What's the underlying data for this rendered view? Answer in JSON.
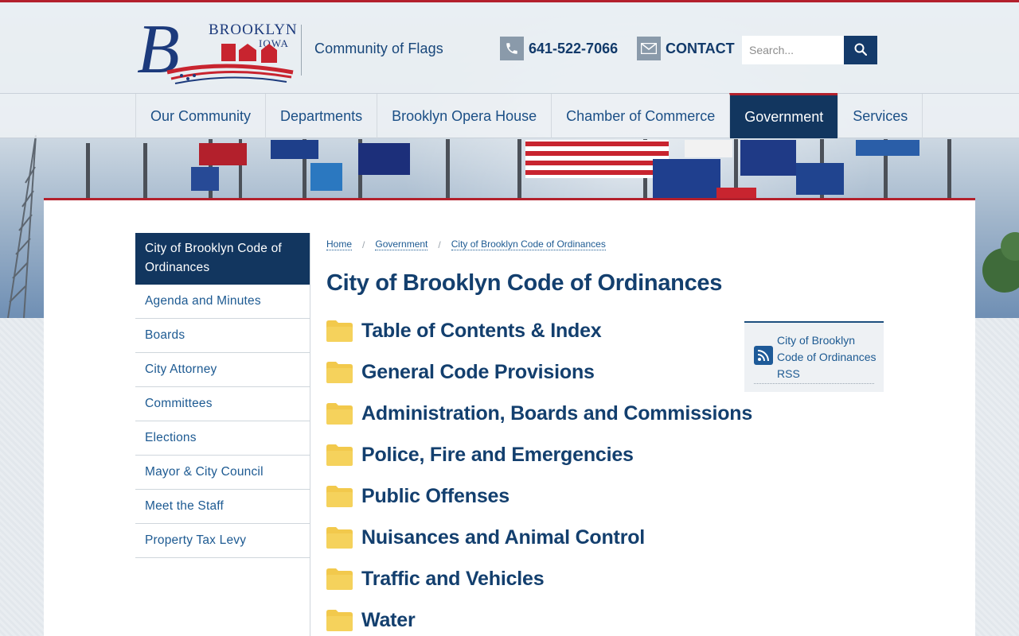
{
  "colors": {
    "accent_red": "#b3202c",
    "navy": "#12365f",
    "link_blue": "#1d5a92",
    "heading_blue": "#133f6e",
    "folder_yellow": "#f2c94c"
  },
  "header": {
    "logo": {
      "wordmark": "BROOKLYN",
      "state": "IOWA",
      "initial": "B"
    },
    "tagline": "Community of Flags",
    "phone": {
      "icon": "phone-icon",
      "number": "641-522-7066"
    },
    "contact": {
      "icon": "mail-icon",
      "label": "CONTACT"
    },
    "search": {
      "placeholder": "Search...",
      "value": "",
      "icon": "search-icon"
    }
  },
  "nav": {
    "items": [
      {
        "label": "Our Community",
        "active": false
      },
      {
        "label": "Departments",
        "active": false
      },
      {
        "label": "Brooklyn Opera House",
        "active": false
      },
      {
        "label": "Chamber of Commerce",
        "active": false
      },
      {
        "label": "Government",
        "active": true
      },
      {
        "label": "Services",
        "active": false
      }
    ]
  },
  "sidebar": {
    "items": [
      {
        "label": "City of Brooklyn Code of Ordinances",
        "active": true
      },
      {
        "label": "Agenda and Minutes",
        "active": false
      },
      {
        "label": "Boards",
        "active": false
      },
      {
        "label": "City Attorney",
        "active": false
      },
      {
        "label": "Committees",
        "active": false
      },
      {
        "label": "Elections",
        "active": false
      },
      {
        "label": "Mayor & City Council",
        "active": false
      },
      {
        "label": "Meet the Staff",
        "active": false
      },
      {
        "label": "Property Tax Levy",
        "active": false
      }
    ]
  },
  "breadcrumb": {
    "items": [
      "Home",
      "Government",
      "City of Brooklyn Code of Ordinances"
    ],
    "separator": "/"
  },
  "main": {
    "title": "City of Brooklyn Code of Ordinances",
    "folders": [
      {
        "label": "Table of Contents & Index",
        "icon": "folder-icon"
      },
      {
        "label": "General Code Provisions",
        "icon": "folder-icon"
      },
      {
        "label": "Administration, Boards and Commissions",
        "icon": "folder-icon"
      },
      {
        "label": "Police, Fire and Emergencies",
        "icon": "folder-icon"
      },
      {
        "label": "Public Offenses",
        "icon": "folder-icon"
      },
      {
        "label": "Nuisances and Animal Control",
        "icon": "folder-icon"
      },
      {
        "label": "Traffic and Vehicles",
        "icon": "folder-icon"
      },
      {
        "label": "Water",
        "icon": "folder-icon"
      }
    ]
  },
  "rss": {
    "icon": "rss-icon",
    "label": "City of Brooklyn Code of Ordinances RSS"
  }
}
